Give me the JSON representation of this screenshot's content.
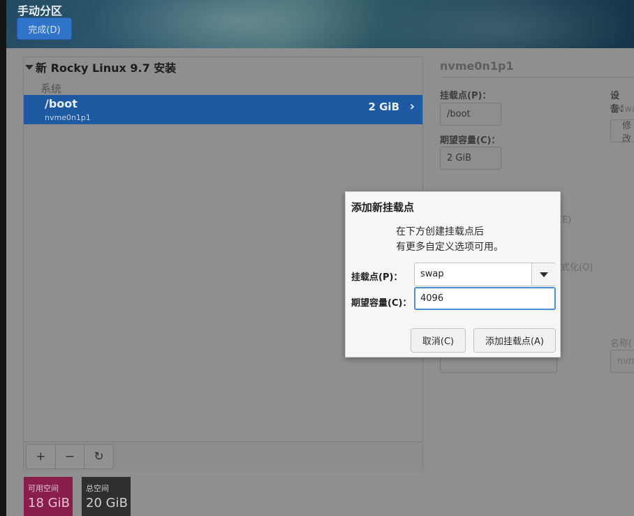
{
  "header": {
    "title": "手动分区",
    "done_button": "完成(D)"
  },
  "left": {
    "install_title": "新 Rocky Linux 9.7 安装",
    "system_label": "系统",
    "selected_row": {
      "path": "/boot",
      "device": "nvme0n1p1",
      "size": "2 GiB",
      "chevron": "›"
    },
    "toolbar": {
      "add": "+",
      "remove": "−",
      "refresh": "↻"
    },
    "available_space": {
      "label": "可用空间",
      "value": "18 GiB"
    },
    "total_space": {
      "label": "总空间",
      "value": "20 GiB"
    }
  },
  "right": {
    "title": "nvme0n1p1",
    "mount_point_label": "挂载点(P)：",
    "mount_point_value": "/boot",
    "desired_capacity_label": "期望容量(C)：",
    "desired_capacity_value": "2 GiB",
    "device_label": "设备：",
    "device_value": "VMwa",
    "modify_button": "修改",
    "encrypt_fragment": "(E)",
    "reformat_fragment": "式化(O)",
    "name_label": "名称(",
    "name_placeholder": "nvm"
  },
  "dialog": {
    "title": "添加新挂载点",
    "description_line1": "在下方创建挂载点后",
    "description_line2": "有更多自定义选项可用。",
    "mount_point_label": "挂载点(P)：",
    "mount_point_value": "swap",
    "capacity_label": "期望容量(C)：",
    "capacity_value": "4096",
    "cancel_button": "取消(C)",
    "add_button": "添加挂载点(A)"
  },
  "colors": {
    "accent": "#2f74c9",
    "selected_row": "#1e5aa1",
    "available_space": "#8a1e4a",
    "total_space": "#2f2f2f"
  }
}
